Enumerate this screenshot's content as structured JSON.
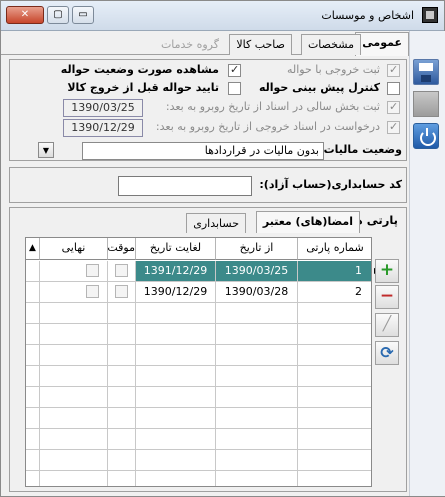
{
  "window": {
    "title": "اشخاص و موسسات",
    "minimize_glyph": "▭",
    "maximize_glyph": "▢",
    "close_glyph": "✕"
  },
  "icons": {
    "app": "app-window-icon",
    "save": "save-icon",
    "power": "power-icon",
    "add": "add-row-icon",
    "delete": "delete-row-icon",
    "edit": "edit-icon",
    "refresh": "refresh-icon"
  },
  "tabs": [
    {
      "label": "عمومی",
      "state": "active"
    },
    {
      "label": "مشخصات",
      "state": "normal"
    },
    {
      "label": "صاحب کالا",
      "state": "normal"
    },
    {
      "label": "گروه خدمات",
      "state": "disabled"
    }
  ],
  "options": {
    "col_right": [
      {
        "label": "ثبت خروجی با حواله",
        "checked": true,
        "disabled": true
      },
      {
        "label": "کنترل پیش بینی حواله",
        "checked": false,
        "disabled": false
      },
      {
        "label": "ثبت بخش سالی در اسناد از تاریخ روبرو به بعد:",
        "checked": true,
        "disabled": true
      },
      {
        "label": "درخواست در اسناد خروجی از تاریخ روبرو به بعد:",
        "checked": true,
        "disabled": true
      }
    ],
    "col_left": [
      {
        "label": "مشاهده صورت وضعیت حواله",
        "checked": true,
        "disabled": false
      },
      {
        "label": "تایید حواله قبل از خروج کالا",
        "checked": false,
        "disabled": false
      }
    ],
    "date_1": "1390/03/25",
    "date_2": "1390/12/29",
    "tax_label": "وضعیت مالیات:",
    "tax_value": "بدون مالیات در قراردادها"
  },
  "free_account": {
    "label": "کد حسابداری(حساب آزاد):",
    "value": ""
  },
  "lower": {
    "side_title": "پارتی های مجاز",
    "subtabs": [
      "امضا(های) معتبر",
      "حسابداری"
    ],
    "columns": [
      "شماره پارتی",
      "از تاریخ",
      "لغایت تاریخ",
      "موقت",
      "نهایی"
    ],
    "rows": [
      {
        "num": "1",
        "from": "1390/03/25",
        "to": "1391/12/29",
        "temp": false,
        "final": false,
        "selected": true
      },
      {
        "num": "2",
        "from": "1390/03/28",
        "to": "1390/12/29",
        "temp": false,
        "final": false,
        "selected": false
      }
    ],
    "row_indicator": "▶"
  },
  "colors": {
    "selected_row": "#3c8a8a",
    "add_green": "#2a9a2a",
    "delete_red": "#c02a2a",
    "power_blue": "#1f5aa8"
  }
}
